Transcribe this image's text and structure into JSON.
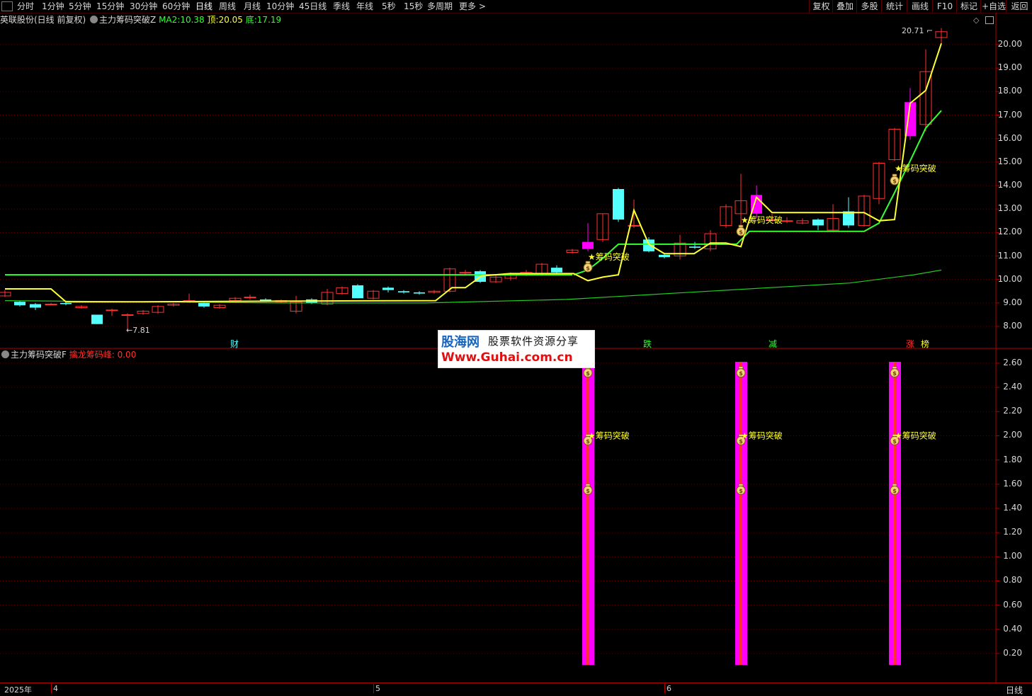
{
  "toolbar": {
    "periods": [
      "分时",
      "1分钟",
      "5分钟",
      "15分钟",
      "30分钟",
      "60分钟",
      "日线",
      "周线",
      "月线",
      "10分钟",
      "45日线",
      "季线",
      "年线",
      "5秒",
      "15秒",
      "多周期",
      "更多 >"
    ],
    "active_period": "日线",
    "right_buttons": [
      "复权",
      "叠加",
      "多股",
      "统计",
      "画线",
      "F10",
      "标记",
      "+自选",
      "返回"
    ]
  },
  "main_panel": {
    "stock_name": "英联股份(日线 前复权)",
    "indicator_name": "主力筹码突破Z",
    "ma2_label": "MA2:",
    "ma2_value": "10.38",
    "top_label": "顶:",
    "top_value": "20.05",
    "bottom_label": "底:",
    "bottom_value": "17.19",
    "high_marker": "20.71",
    "low_marker": "7.81",
    "y_ticks": [
      "20.00",
      "19.00",
      "18.00",
      "17.00",
      "16.00",
      "15.00",
      "14.00",
      "13.00",
      "12.00",
      "11.00",
      "10.00",
      "9.00",
      "8.00"
    ],
    "signal_text": "筹码突破",
    "event_labels": [
      "财",
      "跌",
      "减",
      "涨",
      "榜"
    ]
  },
  "sub_panel": {
    "indicator_name": "主力筹码突破F",
    "series_label": "擒龙筹码峰:",
    "series_value": "0.00",
    "y_ticks": [
      "2.60",
      "2.40",
      "2.20",
      "2.00",
      "1.80",
      "1.60",
      "1.40",
      "1.20",
      "1.00",
      "0.80",
      "0.60",
      "0.40",
      "0.20"
    ],
    "signal_text": "筹码突破"
  },
  "date_axis": {
    "labels": [
      "2025年",
      "4",
      "5",
      "6"
    ],
    "period_label": "日线"
  },
  "watermark": {
    "brand": "股海网",
    "tagline": "股票软件资源分享",
    "url": "Www.Guhai.com.cn"
  },
  "colors": {
    "background": "#000000",
    "up_candle": "#ff3232",
    "down_candle": "#54ffff",
    "ma_yellow": "#ffff33",
    "ma_green": "#33ff33",
    "ma_longterm": "#22cc22",
    "signal_bar": "#ff00ff",
    "grid": "#6a0000"
  }
}
